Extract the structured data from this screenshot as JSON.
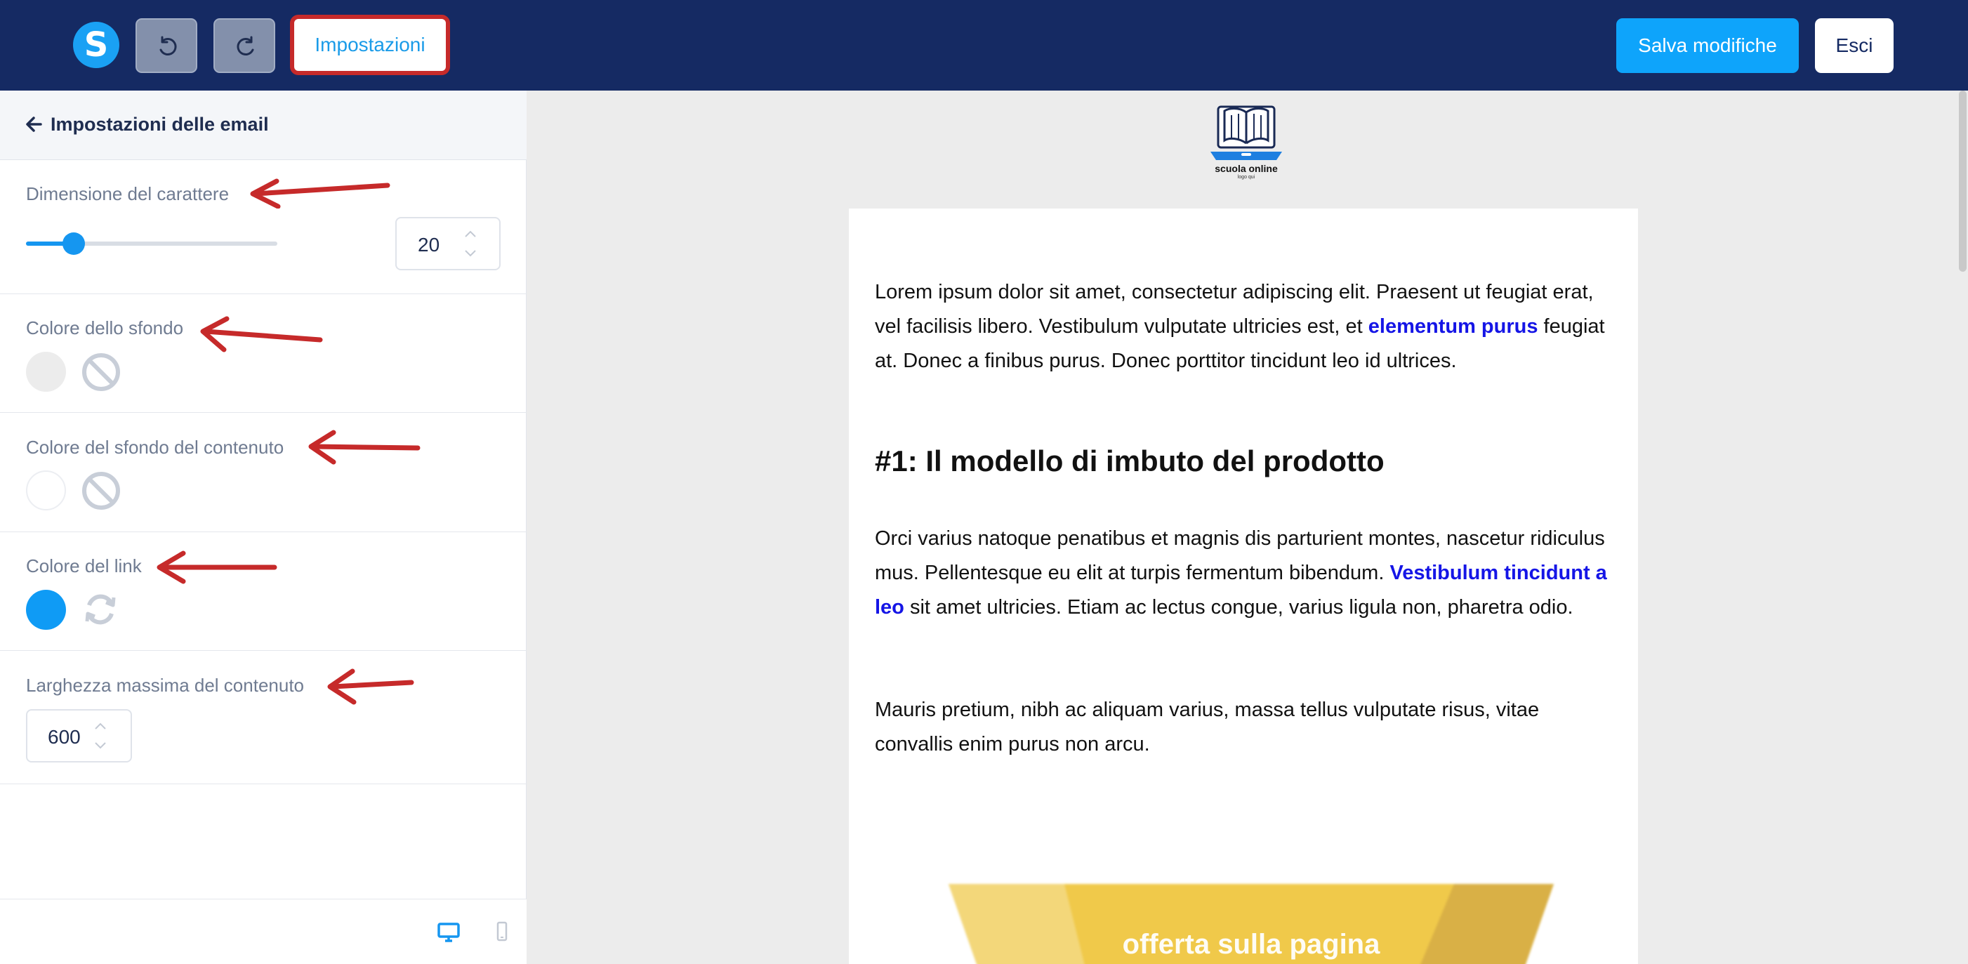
{
  "toolbar": {
    "logo_letter": "S",
    "settings_label": "Impostazioni",
    "save_label": "Salva modifiche",
    "exit_label": "Esci"
  },
  "sidebar": {
    "back_label": "Impostazioni delle email",
    "font_size": {
      "label": "Dimensione del carattere",
      "value": "20",
      "slider_fraction": 0.19
    },
    "background_color": {
      "label": "Colore dello sfondo",
      "swatch": "#ececec"
    },
    "content_background_color": {
      "label": "Colore del sfondo del contenuto",
      "swatch": "#ffffff"
    },
    "link_color": {
      "label": "Colore del link",
      "swatch": "#0f9bf5"
    },
    "max_width": {
      "label": "Larghezza massima del contenuto",
      "value": "600"
    }
  },
  "colors": {
    "topbar": "#152a63",
    "accent": "#0ea4fb",
    "annotation_red": "#c62a2a",
    "link_text": "#1515e6"
  },
  "preview": {
    "logo_title": "scuola online",
    "logo_subtitle": "logo qui",
    "paragraph1_before": "Lorem ipsum dolor sit amet, consectetur adipiscing elit. Praesent ut feugiat erat, vel facilisis libero. Vestibulum vulputate ultricies est, et ",
    "paragraph1_link": "elementum purus",
    "paragraph1_after": " feugiat at. Donec a finibus purus. Donec porttitor tincidunt leo id ultrices.",
    "heading": "#1: Il modello di imbuto del prodotto",
    "paragraph2_before": "Orci varius natoque penatibus et magnis dis parturient montes, nascetur ridiculus mus. Pellentesque eu elit at turpis fermentum bibendum. ",
    "paragraph2_link": "Vestibulum tincidunt a leo",
    "paragraph2_after": " sit amet ultricies. Etiam ac lectus congue, varius ligula non, pharetra odio.",
    "paragraph3": "Mauris pretium, nibh ac aliquam varius, massa tellus vulputate risus, vitae convallis enim purus non arcu.",
    "funnel_label": "offerta sulla pagina"
  },
  "icons": [
    "undo-icon",
    "redo-icon",
    "back-arrow-icon",
    "no-color-icon",
    "reset-icon",
    "desktop-icon",
    "mobile-icon",
    "chevron-up-icon",
    "chevron-down-icon",
    "annotation-arrow"
  ]
}
